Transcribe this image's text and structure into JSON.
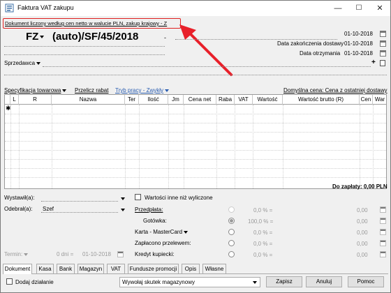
{
  "window": {
    "title": "Faktura VAT zakupu",
    "minimize": "—",
    "maximize": "☐",
    "close": "✕"
  },
  "notice": "Dokument liczony według cen netto w walucie PLN, zakup krajowy - Z",
  "header": {
    "doc_type": "FZ",
    "doc_number": "(auto)/SF/45/2018",
    "date1": "01-10-2018",
    "date2_label": "Data zakończenia dostawy",
    "date2": "01-10-2018",
    "date3_label": "Data otrzymania",
    "date3": "01-10-2018",
    "seller_label": "Sprzedawca",
    "plus": "+"
  },
  "toolbar": {
    "spec": "Specyfikacja towarowa",
    "recalc": "Przelicz rabat",
    "mode": "Tryb pracy - Zwykły",
    "default_price": "Domyślna cena: Cena z ostatniej dostawy"
  },
  "grid": {
    "columns": [
      "L",
      "R",
      "Nazwa",
      "Ter",
      "Ilość",
      "Jm",
      "Cena net",
      "Raba",
      "VAT",
      "Wartość",
      "Wartość brutto (R)",
      "Cen",
      "War"
    ],
    "new_row_marker": "✱"
  },
  "total": "Do zapłaty: 0,00 PLN",
  "bottom": {
    "issued_label": "Wystawił(a):",
    "received_label": "Odebrał(a):",
    "received_value": "Szef",
    "other_values_label": "Wartości inne niż wyliczone",
    "prepay_label": "Przedpłata:",
    "cash_label": "Gotówka:",
    "card_label": "Karta - MasterCard",
    "transfer_label": "Zapłacono przelewem:",
    "credit_label": "Kredyt kupiecki:",
    "pct_zero": "0,0 % =",
    "pct_full": "100,0 % =",
    "amount": "0,00",
    "term_label": "Termin:",
    "term_days": "0 dni =",
    "term_date": "01-10-2018"
  },
  "tabs": [
    "Dokument",
    "Kasa",
    "Bank",
    "Magazyn",
    "VAT",
    "Fundusze promocji",
    "Opis",
    "Własne"
  ],
  "footer": {
    "add_action": "Dodaj działanie",
    "warehouse_effect": "Wywołaj skutek magazynowy",
    "save": "Zapisz",
    "cancel": "Anuluj",
    "help": "Pomoc"
  },
  "colors": {
    "highlight": "#e02020",
    "arrow": "#e8202a",
    "link": "#2a5db0"
  }
}
